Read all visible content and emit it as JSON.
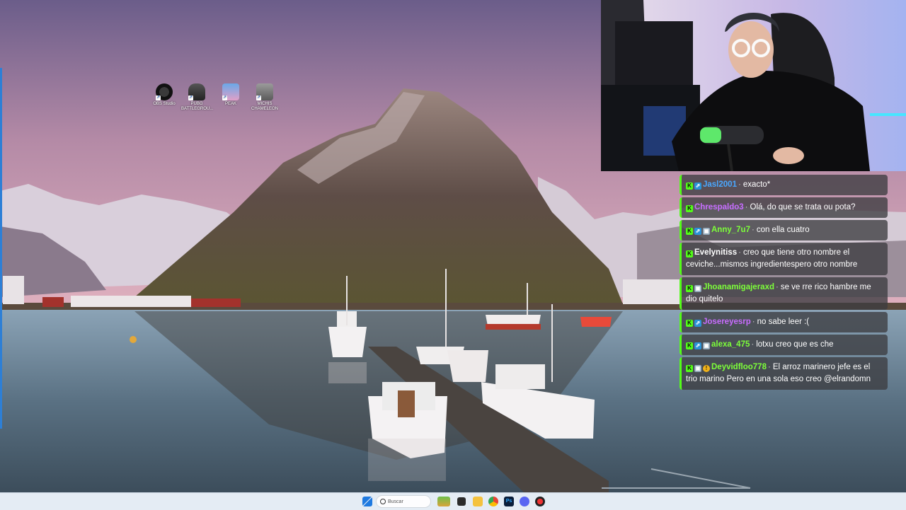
{
  "desktop": {
    "icons": [
      {
        "label": "OBS Studio",
        "icon": "obs-icon"
      },
      {
        "label": "PUBG BATTLEGROU...",
        "icon": "pubg-icon"
      },
      {
        "label": "PEAK",
        "icon": "peak-icon"
      },
      {
        "label": "MICHIS CHAMELEON",
        "icon": "chameleon-icon"
      }
    ]
  },
  "chat": {
    "messages": [
      {
        "user": "Jasl2001",
        "color": "#4aa8ff",
        "badges": [
          "k",
          "sub"
        ],
        "text": "exacto*"
      },
      {
        "user": "Chrespaldo3",
        "color": "#c86cff",
        "badges": [
          "k"
        ],
        "text": "Olá, do que se trata ou pota?"
      },
      {
        "user": "Anny_7u7",
        "color": "#7dff3a",
        "badges": [
          "k",
          "sub",
          "gift"
        ],
        "text": "con ella cuatro"
      },
      {
        "user": "Evelynitiss",
        "color": "#ffffff",
        "badges": [
          "k"
        ],
        "text": "creo que tiene otro nombre el ceviche...mismos ingredientespero otro nombre"
      },
      {
        "user": "Jhoanamigajeraxd",
        "color": "#7dff3a",
        "badges": [
          "k",
          "gift"
        ],
        "text": "se ve rre rico hambre me dio quitelo"
      },
      {
        "user": "Josereyesrp",
        "color": "#c86cff",
        "badges": [
          "k",
          "sub"
        ],
        "text": "no sabe leer :("
      },
      {
        "user": "alexa_475",
        "color": "#7dff3a",
        "badges": [
          "k",
          "sub",
          "gift"
        ],
        "text": "lotxu creo que es che"
      },
      {
        "user": "Deyvidfloo778",
        "color": "#7dff3a",
        "badges": [
          "k",
          "gift",
          "excl"
        ],
        "text": "El arroz marinero jefe es el trio marino Pero en una sola eso creo @elrandomn"
      }
    ]
  },
  "taskbar": {
    "search_placeholder": "Buscar",
    "apps": [
      "start-icon",
      "widgets-icon",
      "task-view-icon",
      "file-explorer-icon",
      "chrome-icon",
      "photoshop-icon",
      "discord-icon",
      "app-icon"
    ]
  },
  "colors": {
    "kick_green": "#53fc18",
    "chat_bg": "#3c3c40",
    "taskbar_bg": "#e4ecf4",
    "sky_top": "#6b5d8a",
    "sky_horizon": "#d9a7b8",
    "water": "#5a7183"
  }
}
